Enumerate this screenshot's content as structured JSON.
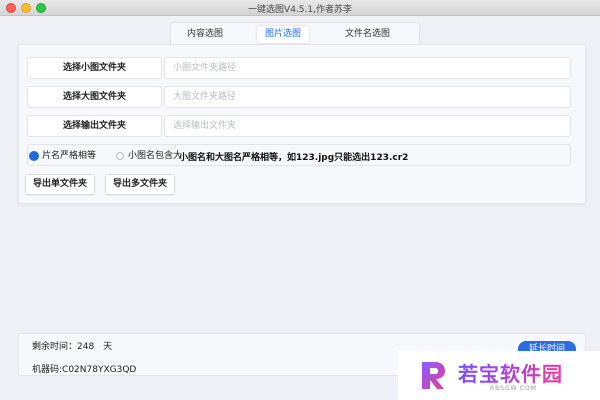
{
  "window": {
    "title": "一键选图V4.5.1,作者苏李"
  },
  "tabs": [
    {
      "label": "内容选图"
    },
    {
      "label": "图片选图"
    },
    {
      "label": "文件名选图"
    }
  ],
  "form": {
    "small_folder": {
      "button": "选择小图文件夹",
      "placeholder": "小图文件夹路径"
    },
    "large_folder": {
      "button": "选择大图文件夹",
      "placeholder": "大图文件夹路径"
    },
    "output_folder": {
      "button": "选择输出文件夹",
      "placeholder": "选择输出文件夹"
    },
    "match_mode": {
      "options": [
        "片名严格相等",
        "小图名包含大"
      ],
      "selected": "片名严格相等",
      "hint": "小图名和大图名严格相等，如123.jpg只能选出123.cr2"
    },
    "export_single": "导出单文件夹",
    "export_multi": "导出多文件夹"
  },
  "footer": {
    "remaining_label": "剩余时间：248　天",
    "machine_code": "机器码:C02N78YXG3QD",
    "extend_button": "延长时间"
  },
  "watermark": {
    "text": "若宝软件园",
    "sub": "RBSGW.COM"
  },
  "colors": {
    "accent": "#1f6bd8",
    "extend_button": "#2b6de0"
  }
}
